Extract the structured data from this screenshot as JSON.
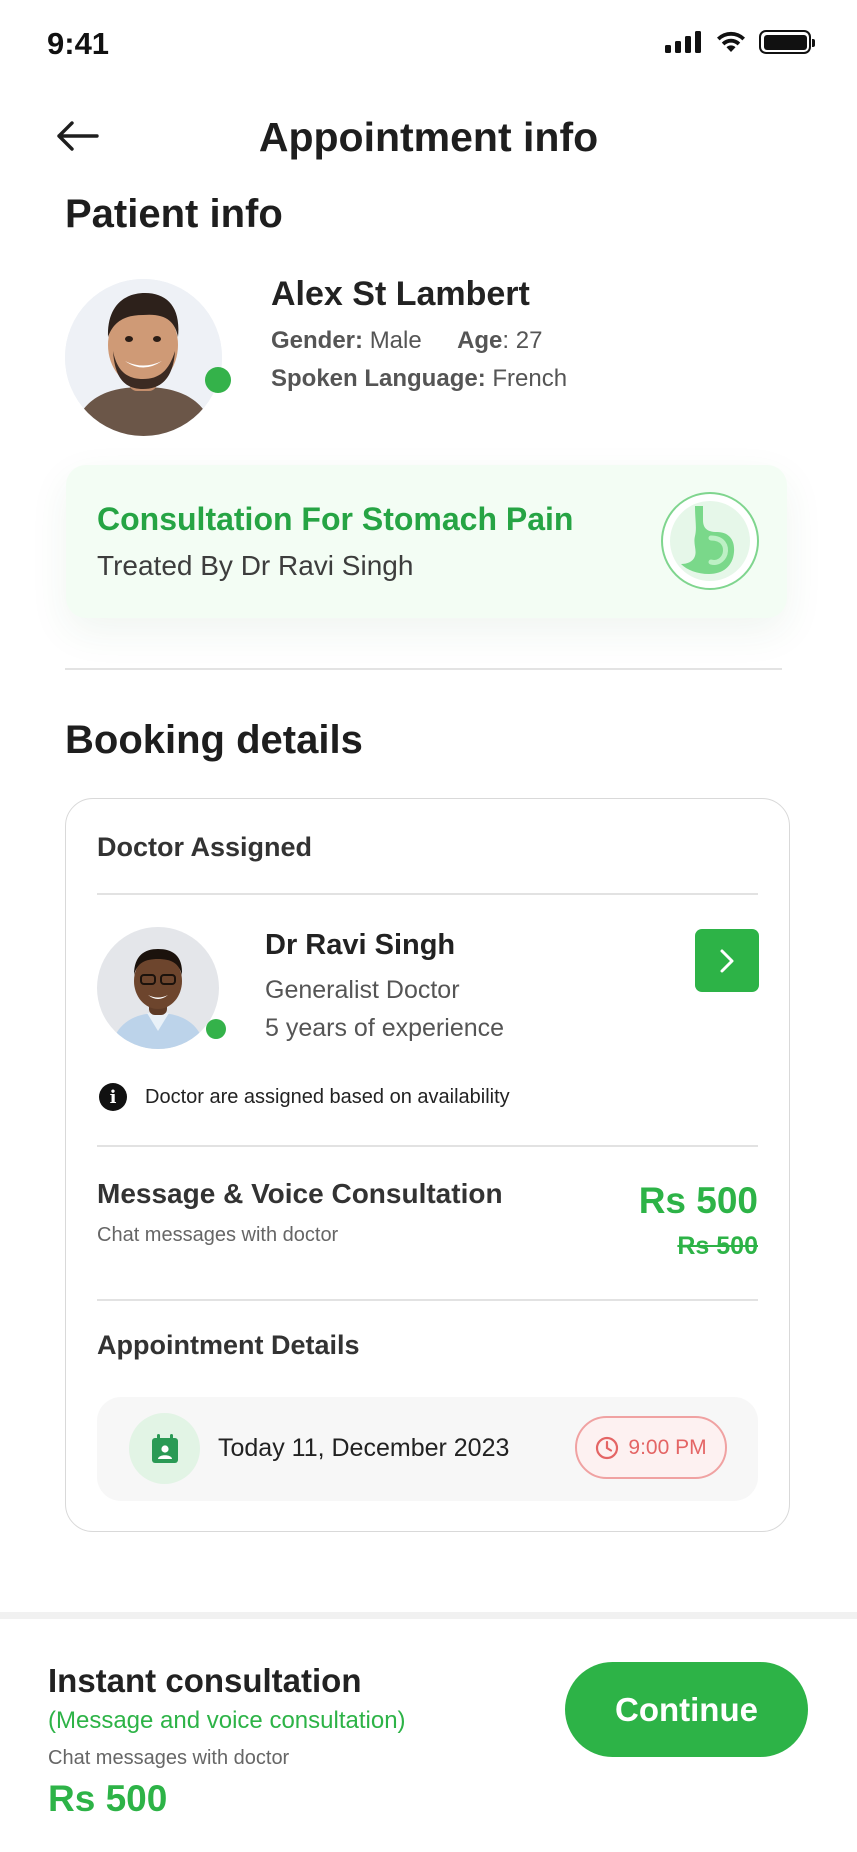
{
  "status_bar": {
    "time": "9:41"
  },
  "header": {
    "title": "Appointment info"
  },
  "patient_section": {
    "title": "Patient info",
    "name": "Alex St Lambert",
    "gender_label": "Gender:",
    "gender": "Male",
    "age_label": "Age",
    "age": ": 27",
    "language_label": "Spoken Language:",
    "language": "French"
  },
  "consultation": {
    "title": "Consultation For Stomach Pain",
    "treated_by": "Treated By Dr Ravi Singh",
    "icon": "stomach-icon"
  },
  "booking": {
    "title": "Booking details",
    "doctor_heading": "Doctor  Assigned",
    "doctor": {
      "name": "Dr Ravi Singh",
      "specialty": "Generalist Doctor",
      "experience": "5 years of experience"
    },
    "availability_note": "Doctor are assigned based on availability",
    "plan": {
      "title": "Message & Voice Consultation",
      "subtitle": "Chat messages with doctor",
      "price": "Rs 500",
      "old_price": "Rs 500"
    },
    "appointment_heading": "Appointment Details",
    "date": "Today 11, December 2023",
    "time": "9:00 PM"
  },
  "bottom_bar": {
    "title": "Instant consultation",
    "subtitle": "(Message and voice consultation)",
    "note": "Chat messages with doctor",
    "price": "Rs 500",
    "button": "Continue"
  },
  "colors": {
    "accent_green": "#2db347",
    "consult_bg": "#f3fdf4",
    "time_red": "#e46565"
  }
}
